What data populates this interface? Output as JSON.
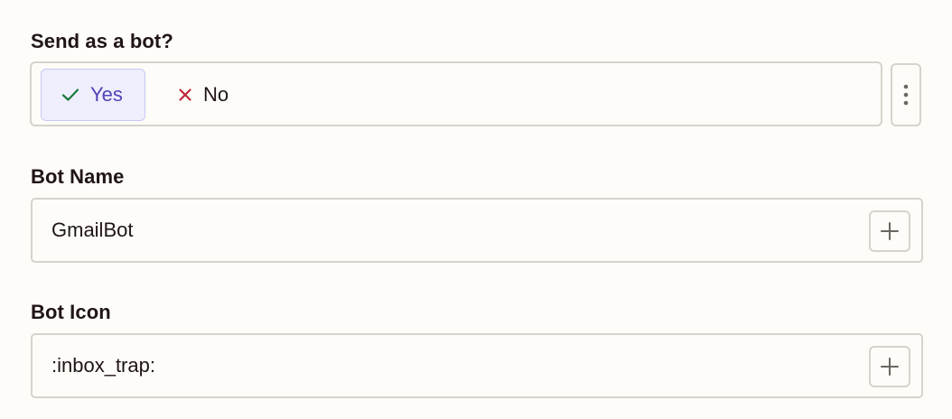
{
  "send_as_bot": {
    "label": "Send as a bot?",
    "options": [
      {
        "label": "Yes",
        "icon": "check-icon",
        "selected": true
      },
      {
        "label": "No",
        "icon": "x-icon",
        "selected": false
      }
    ],
    "more_icon": "kebab-menu-icon"
  },
  "bot_name": {
    "label": "Bot Name",
    "value": "GmailBot",
    "action_icon": "plus-icon"
  },
  "bot_icon": {
    "label": "Bot Icon",
    "value": ":inbox_trap:",
    "action_icon": "plus-icon"
  },
  "colors": {
    "selected_text": "#4f44b8",
    "selected_bg": "#eeeefc",
    "check": "#1a7a3c",
    "x": "#c0263a",
    "border": "#d6d3cc",
    "background": "#fdfcf8"
  }
}
